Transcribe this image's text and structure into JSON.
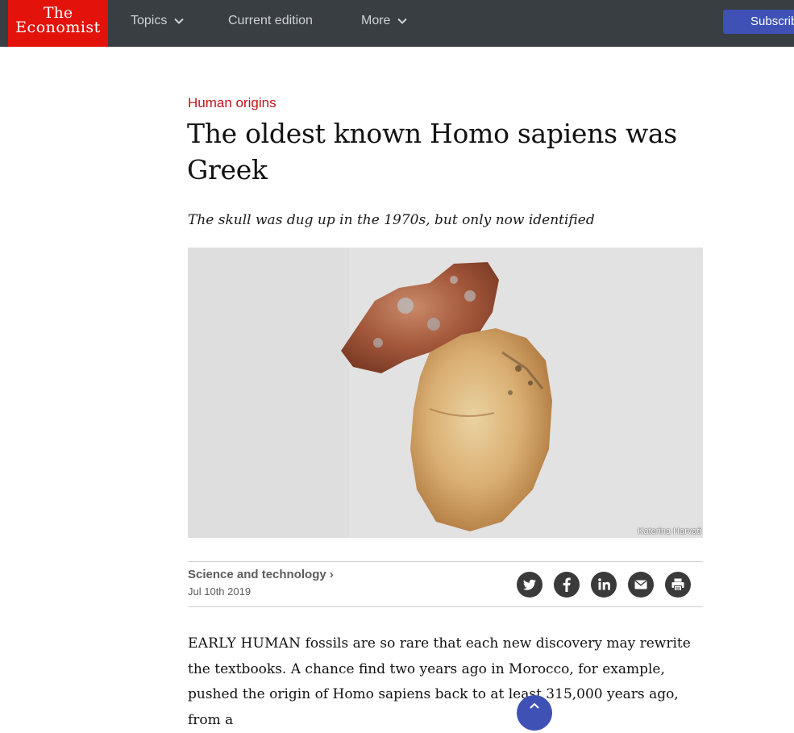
{
  "brand": {
    "logo_line1": "The",
    "logo_line2": "Economist"
  },
  "nav": {
    "topics_label": "Topics",
    "current_edition_label": "Current edition",
    "more_label": "More",
    "subscribe_label": "Subscribe"
  },
  "article": {
    "rubric": "Human origins",
    "headline": "The oldest known Homo sapiens was Greek",
    "subhead": "The skull was dug up in the 1970s, but only now identified",
    "image_credit": "Katerina Harvati",
    "section": "Science and technology",
    "date": "Jul 10th 2019",
    "body_lead": "EARLY HUMAN",
    "body_rest": " fossils are so rare that each new discovery may rewrite the textbooks. A chance find two years ago in Morocco, for example, pushed the origin of Homo sapiens back to at least 315,000 years ago, from a"
  },
  "share": [
    "twitter-icon",
    "facebook-icon",
    "linkedin-icon",
    "email-icon",
    "print-icon"
  ],
  "colors": {
    "topbar": "#383e42",
    "logo_red": "#e3120b",
    "rubric_red": "#c0141a",
    "subscribe_blue": "#3f51b5",
    "share_circle": "#3a3a3a"
  }
}
